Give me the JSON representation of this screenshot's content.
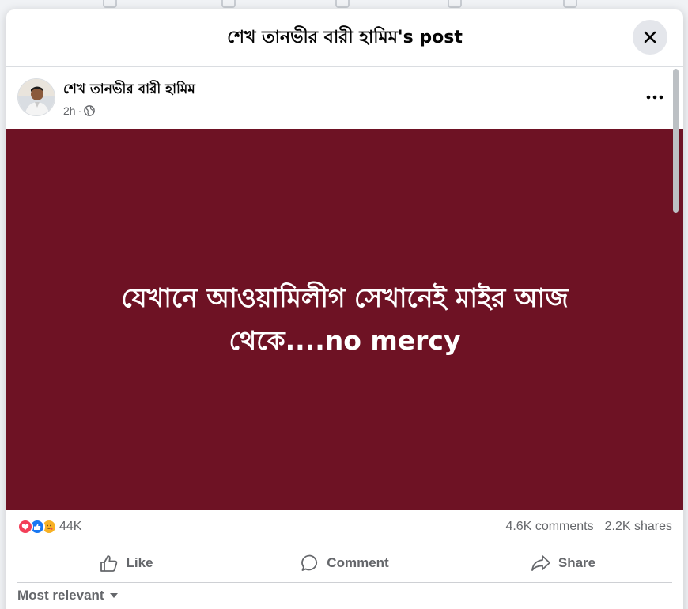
{
  "modal": {
    "title": "শেখ তানভীর বারী হামিম's post"
  },
  "post": {
    "author": "শেখ তানভীর বারী হামিম",
    "time": "2h",
    "separator": "·",
    "audience_icon": "globe-icon",
    "more_icon": "more-horizontal-icon",
    "image_text": "যেখানে আওয়ামিলীগ সেখানেই মাইর আজ\nথেকে....no mercy",
    "image_background": "#6e1224"
  },
  "stats": {
    "reaction_icons": [
      "love-reaction-icon",
      "like-reaction-icon",
      "care-reaction-icon"
    ],
    "reaction_count": "44K",
    "comments": "4.6K comments",
    "shares": "2.2K shares"
  },
  "actions": {
    "like": "Like",
    "comment": "Comment",
    "share": "Share"
  },
  "comments_sort": {
    "label": "Most relevant"
  },
  "colors": {
    "secondary_text": "#65676b",
    "divider": "#ced0d4",
    "like_blue": "#1877f2",
    "love_red": "#f33e58"
  }
}
